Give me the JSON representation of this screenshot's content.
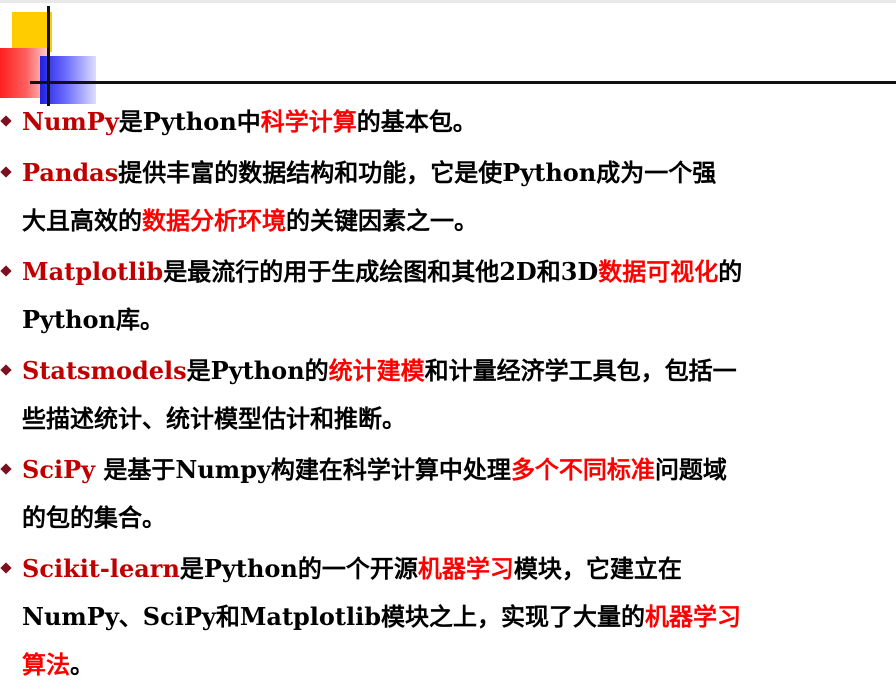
{
  "items": [
    {
      "lines": [
        [
          {
            "t": "NumPy",
            "c": "kw"
          },
          {
            "t": "是Python中"
          },
          {
            "t": "科学计算",
            "c": "hl"
          },
          {
            "t": "的基本包。"
          }
        ]
      ]
    },
    {
      "lines": [
        [
          {
            "t": "Pandas",
            "c": "kw"
          },
          {
            "t": "提供丰富的数据结构和功能，它是使Python成为一个强"
          }
        ],
        [
          {
            "t": "大且高效的"
          },
          {
            "t": "数据分析环境",
            "c": "hl"
          },
          {
            "t": "的关键因素之一。"
          }
        ]
      ]
    },
    {
      "lines": [
        [
          {
            "t": "Matplotlib",
            "c": "kw"
          },
          {
            "t": "是最流行的用于生成绘图和其他2D和3D"
          },
          {
            "t": "数据可视化",
            "c": "hl"
          },
          {
            "t": "的"
          }
        ],
        [
          {
            "t": "Python库。"
          }
        ]
      ]
    },
    {
      "lines": [
        [
          {
            "t": "Statsmodels",
            "c": "kw"
          },
          {
            "t": "是Python的"
          },
          {
            "t": "统计建模",
            "c": "hl"
          },
          {
            "t": "和计量经济学工具包，包括一"
          }
        ],
        [
          {
            "t": "些描述统计、统计模型估计和推断。"
          }
        ]
      ]
    },
    {
      "lines": [
        [
          {
            "t": "SciPy",
            "c": "kw"
          },
          {
            "t": " 是基于Numpy构建在科学计算中处理"
          },
          {
            "t": "多个不同标准",
            "c": "hl"
          },
          {
            "t": "问题域"
          }
        ],
        [
          {
            "t": "的包的集合。"
          }
        ]
      ]
    },
    {
      "lines": [
        [
          {
            "t": "Scikit-learn",
            "c": "kw"
          },
          {
            "t": "是Python的一个开源"
          },
          {
            "t": "机器学习",
            "c": "hl"
          },
          {
            "t": "模块，它建立在"
          }
        ],
        [
          {
            "t": "NumPy、SciPy和Matplotlib模块之上，实现了大量的"
          },
          {
            "t": "机器学习",
            "c": "hl"
          }
        ],
        [
          {
            "t": "算法",
            "c": "hl"
          },
          {
            "t": "。"
          }
        ]
      ]
    }
  ]
}
